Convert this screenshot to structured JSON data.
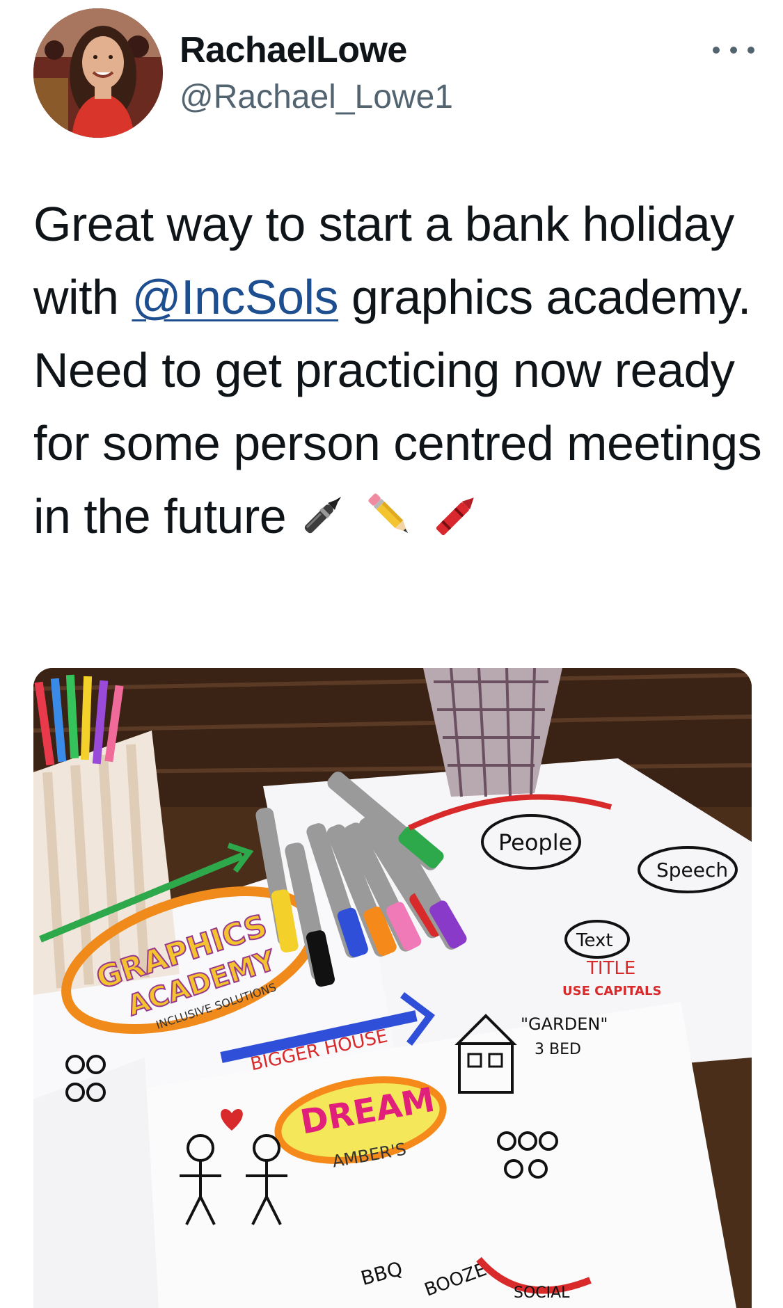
{
  "author": {
    "display_name": "RachaelLowe",
    "handle": "@Rachael_Lowe1",
    "avatar_icon": "profile-photo"
  },
  "more_icon": "ellipsis-icon",
  "tweet": {
    "text_before_mention": "Great way to start a bank holiday with ",
    "mention": "@IncSols",
    "text_after_mention": " graphics academy. Need to get practicing now ready for some person centred meetings in the future",
    "emojis": [
      "pen-icon",
      "pencil-icon",
      "crayon-icon"
    ]
  },
  "media": {
    "description_icon": "graphics-academy-photo",
    "drawn_text": {
      "graphics": "GRAPHICS",
      "academy": "ACADEMY",
      "inclusive": "INCLUSIVE SOLUTIONS",
      "people": "People",
      "speech": "Speech",
      "text": "Text",
      "title": "TITLE",
      "use_capitals": "USE CAPITALS",
      "bigger_house": "BIGGER HOUSE",
      "dream": "DREAM",
      "ambers": "AMBER'S",
      "garden": "\"GARDEN\"",
      "three_bed": "3 BED",
      "bbq": "BBQ",
      "booze": "BOOZE",
      "social": "SOCIAL"
    }
  },
  "colors": {
    "text": "#0f1419",
    "secondary": "#536471",
    "mention": "#1d4e8f"
  }
}
